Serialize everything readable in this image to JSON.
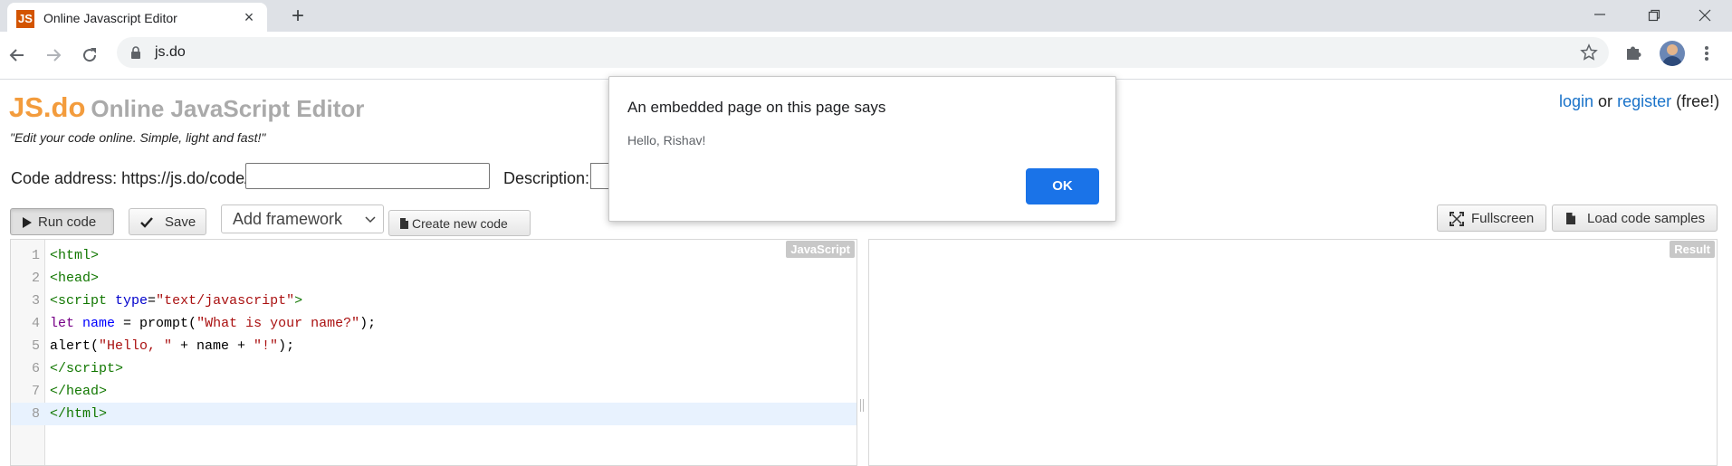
{
  "browser": {
    "tab": {
      "favicon_text": "JS",
      "title": "Online Javascript Editor",
      "close_glyph": "×"
    },
    "new_tab_glyph": "+",
    "url": "js.do",
    "colors": {
      "favicon_bg": "#d35400",
      "accent": "#1a73e8"
    }
  },
  "site": {
    "logo_main": "JS.do",
    "logo_sub": "Online JavaScript Editor",
    "tagline": "\"Edit your code online. Simple, light and fast!\"",
    "auth": {
      "login": "login",
      "or": "or",
      "register": "register",
      "free": "(free!)"
    }
  },
  "form": {
    "address_label": "Code address: https://js.do/code/",
    "address_value": "",
    "description_label": "Description:"
  },
  "buttons": {
    "run": "Run code",
    "save": "Save",
    "framework_select": "Add framework",
    "create_new": "Create new code",
    "fullscreen": "Fullscreen",
    "load_samples": "Load code samples"
  },
  "editor": {
    "badge": "JavaScript",
    "active_line": 8,
    "lines": [
      {
        "n": "1"
      },
      {
        "n": "2"
      },
      {
        "n": "3"
      },
      {
        "n": "4"
      },
      {
        "n": "5"
      },
      {
        "n": "6"
      },
      {
        "n": "7"
      },
      {
        "n": "8"
      }
    ]
  },
  "result": {
    "badge": "Result"
  },
  "dialog": {
    "title": "An embedded page on this page says",
    "message": "Hello, Rishav!",
    "ok": "OK"
  }
}
